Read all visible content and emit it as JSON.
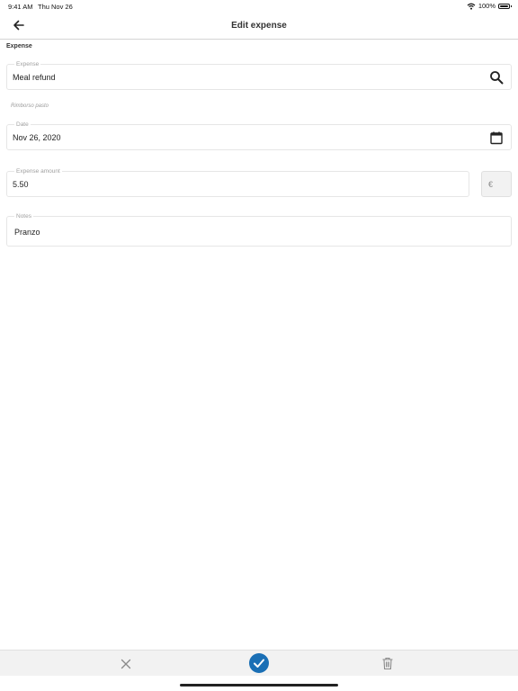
{
  "status_bar": {
    "time": "9:41 AM",
    "date": "Thu Nov 26",
    "battery": "100%"
  },
  "header": {
    "title": "Edit expense",
    "back_icon": "arrow-left-icon"
  },
  "section": {
    "title": "Expense"
  },
  "fields": {
    "expense": {
      "label": "Expense",
      "value": "Meal refund",
      "icon": "search-icon"
    },
    "hint": "Rimborso pasto",
    "date": {
      "label": "Date",
      "value": "Nov 26, 2020",
      "icon": "calendar-icon"
    },
    "amount": {
      "label": "Expense amount",
      "value": "5.50",
      "currency": "€"
    },
    "notes": {
      "label": "Notes",
      "value": "Pranzo"
    }
  },
  "toolbar": {
    "cancel_icon": "close-icon",
    "confirm_icon": "checkmark-icon",
    "delete_icon": "trash-icon",
    "accent_color": "#1a6fb5"
  }
}
